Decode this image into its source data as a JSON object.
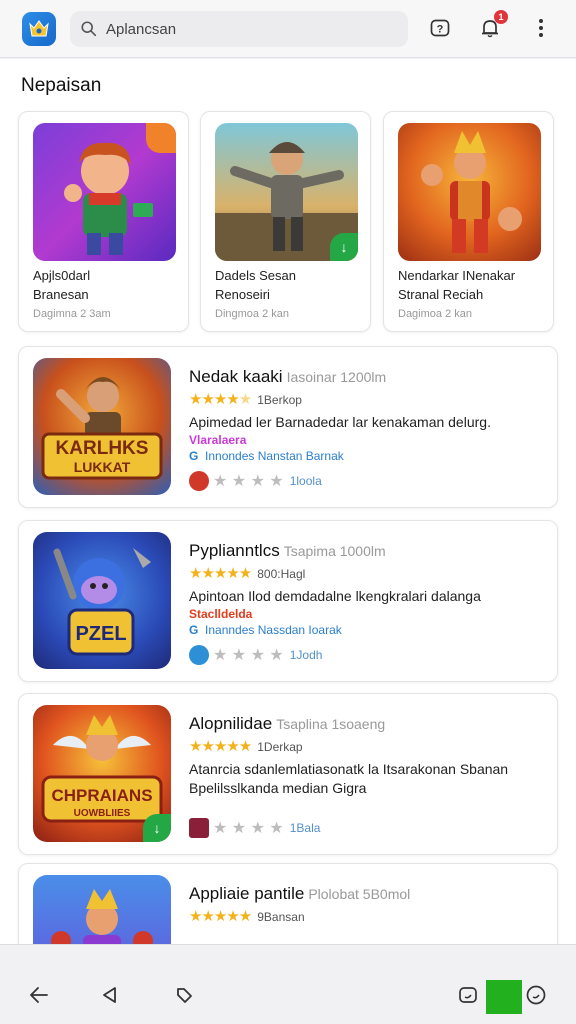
{
  "topbar": {
    "search_placeholder": "Aplancsan",
    "notification_count": "1",
    "icons": [
      "app-logo-icon",
      "search-icon",
      "help-icon",
      "bell-icon",
      "more-vert-icon"
    ]
  },
  "section": {
    "title": "Nepaisan"
  },
  "featured": [
    {
      "line1": "Apjls0darl",
      "line2": "Branesan",
      "meta": "Dagimna 2 3am"
    },
    {
      "line1": "Dadels Sesan",
      "line2": "Renoseiri",
      "meta": "Dingmoa 2 kan"
    },
    {
      "line1": "Nendarkar INenakar",
      "line2": "Stranal  Reciah",
      "meta": "Dagimoa 2 kan"
    }
  ],
  "list": [
    {
      "title": "Nedak kaaki",
      "subtitle": "Iasoinar 1200lm",
      "rating_text": "1Berkop",
      "stars": 4.5,
      "description": "Apimedad ler Barnadedar lar kenakaman delurg.",
      "tag": "Vlaralaera",
      "tag_color": "#c83ad6",
      "developer": "Innondes Nanstan Barnak",
      "developer_prefix": "G",
      "mini_text": "1loola",
      "mini_icon_color": "#d0382a"
    },
    {
      "title": "Pyplianntlcs",
      "subtitle": "Tsapima 1000lm",
      "rating_text": "800:Hagl",
      "stars": 5,
      "description": "Apintoan Ilod demdadalne lkengkralari dalanga",
      "tag": "Staclldelda",
      "tag_color": "#e23c1d",
      "developer": "Inanndes Nassdan Ioarak",
      "developer_prefix": "G",
      "mini_text": "1Jodh",
      "mini_icon_color": "#2d8fd6"
    },
    {
      "title": "Alopnilidae",
      "subtitle": "Tsaplina 1soaeng",
      "rating_text": "1Derkap",
      "stars": 5,
      "description": "Atanrcia sdanlemlatiasonatk la Itsarakonan Sbanan",
      "description2": "Bpelilsslkanda median Gigra",
      "tag": "",
      "tag_color": "#ffffff",
      "developer": "",
      "developer_prefix": "",
      "mini_text": "1Bala",
      "mini_icon_color": "#8a1f3a"
    },
    {
      "title": "Appliaie pantile",
      "subtitle": "Plolobat 5B0mol",
      "rating_text": "9Bansan",
      "stars": 5,
      "description": "",
      "tag": "",
      "tag_color": "#ffffff",
      "developer": "",
      "developer_prefix": "",
      "mini_text": "",
      "mini_icon_color": "#ffffff"
    }
  ],
  "bottom_nav": {
    "icons": [
      "back-arrow-icon",
      "nav-back-triangle-icon",
      "tag-icon",
      "screenshot-icon",
      "green-square-indicator",
      "emoji-icon"
    ]
  },
  "colors": {
    "star": "#f3b21b",
    "accent_green": "#22b01f",
    "badge_red": "#e0353b"
  }
}
